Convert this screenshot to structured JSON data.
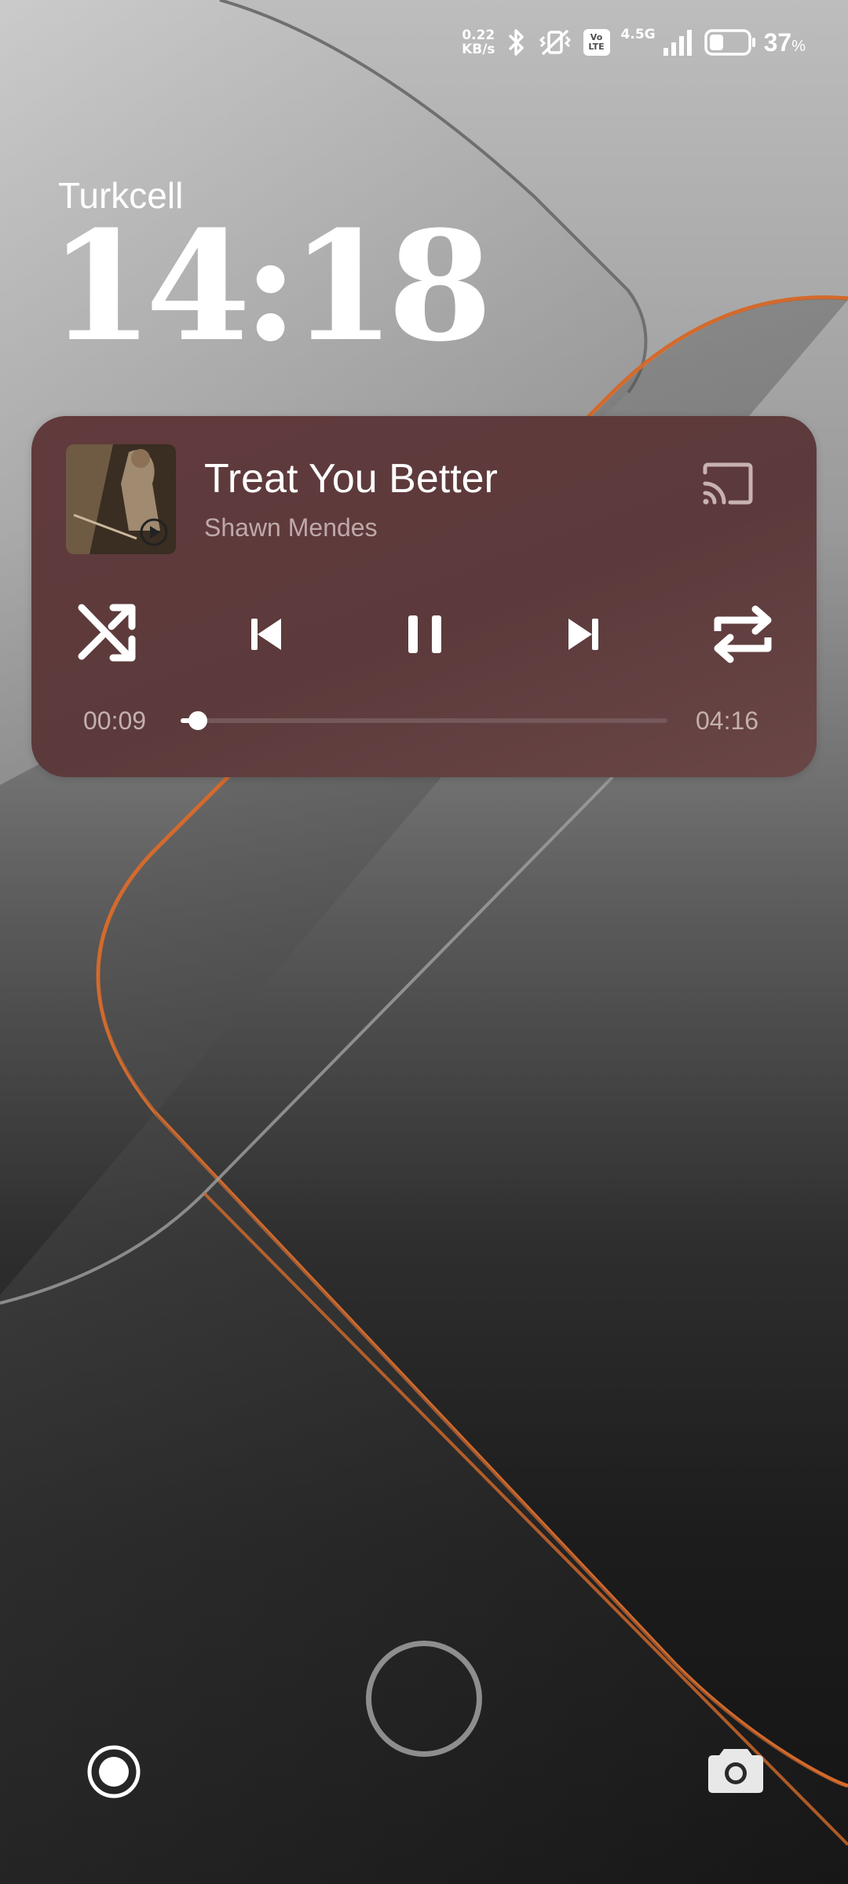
{
  "status_bar": {
    "net_speed_value": "0.22",
    "net_speed_unit": "KB/s",
    "volte_top": "Vo",
    "volte_bottom": "LTE",
    "network_type": "4.5G",
    "battery_percent": "37",
    "battery_percent_sign": "%",
    "battery_level": 0.37,
    "icons": [
      "bluetooth-icon",
      "vibrate-icon",
      "volte-icon",
      "signal-icon",
      "battery-icon"
    ]
  },
  "lockscreen": {
    "carrier": "Turkcell",
    "time": "14:18"
  },
  "media_player": {
    "title": "Treat You Better",
    "artist": "Shawn Mendes",
    "elapsed": "00:09",
    "duration": "04:16",
    "progress": 0.035,
    "state": "playing",
    "controls": [
      "shuffle-icon",
      "previous-icon",
      "pause-icon",
      "next-icon",
      "repeat-icon",
      "cast-icon"
    ]
  },
  "shortcuts": {
    "left_icon": "record-icon",
    "center_icon": "unlock-ring",
    "right_icon": "camera-icon"
  },
  "colors": {
    "card_bg": "#5f3a3c",
    "accent_orange": "#d46a2c",
    "text_primary": "#ffffff",
    "text_secondary": "#bfa9a8"
  }
}
